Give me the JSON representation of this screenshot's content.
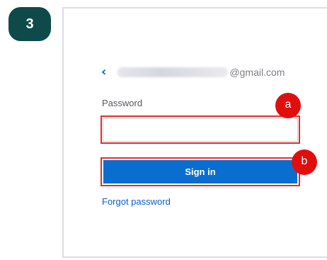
{
  "step": {
    "number": "3"
  },
  "login": {
    "back_icon": "chevron-left-icon",
    "email_domain": "@gmail.com",
    "password_label": "Password",
    "password_value": "",
    "password_placeholder": "",
    "signin_label": "Sign in",
    "forgot_label": "Forgot password"
  },
  "annotations": {
    "a": "a",
    "b": "b"
  },
  "colors": {
    "step_badge": "#0e4a4a",
    "accent_blue": "#0a6ed1",
    "link_blue": "#0a5ed7",
    "highlight_red": "#e32d2d",
    "marker_red": "#e10e0e"
  }
}
